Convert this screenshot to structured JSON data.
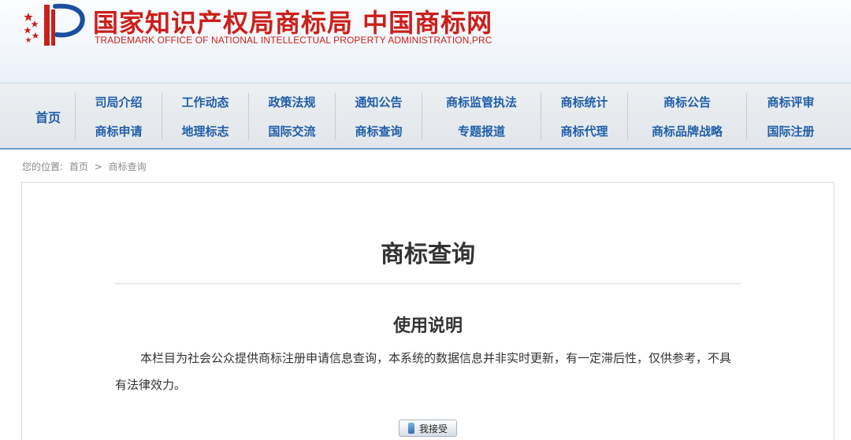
{
  "header": {
    "title": "国家知识产权局商标局 中国商标网",
    "subtitle": "TRADEMARK OFFICE OF NATIONAL INTELLECTUAL PROPERTY ADMINISTRATION,PRC"
  },
  "nav": {
    "home": "首页",
    "columns": [
      {
        "top": "司局介绍",
        "bottom": "商标申请"
      },
      {
        "top": "工作动态",
        "bottom": "地理标志"
      },
      {
        "top": "政策法规",
        "bottom": "国际交流"
      },
      {
        "top": "通知公告",
        "bottom": "商标查询"
      },
      {
        "top": "商标监管执法",
        "bottom": "专题报道"
      },
      {
        "top": "商标统计",
        "bottom": "商标代理"
      },
      {
        "top": "商标公告",
        "bottom": "商标品牌战略"
      },
      {
        "top": "商标评审",
        "bottom": "国际注册"
      }
    ]
  },
  "breadcrumb": {
    "prefix": "您的位置:",
    "home": "首页",
    "separator": ">",
    "current": "商标查询"
  },
  "main": {
    "title": "商标查询",
    "section_title": "使用说明",
    "description": "本栏目为社会公众提供商标注册申请信息查询，本系统的数据信息并非实时更新，有一定滞后性，仅供参考，不具有法律效力。",
    "accept_label": "我接受"
  },
  "colors": {
    "brand_red": "#cc1f1a",
    "nav_blue": "#1f5ea9",
    "nav_border": "#6a9fd0"
  },
  "icons": {
    "logo": "trademark-office-emblem-icon",
    "button": "button-bar-icon"
  }
}
